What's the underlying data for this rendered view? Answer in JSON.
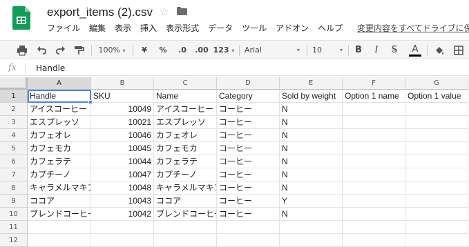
{
  "title_bar": {
    "app_icon": "sheets-icon",
    "filename": "export_items (2).csv",
    "star_icon": "star-icon",
    "folder_icon": "folder-icon",
    "last_edit": "変更内容をすべてドライブに保"
  },
  "menu": [
    "ファイル",
    "編集",
    "表示",
    "挿入",
    "表示形式",
    "データ",
    "ツール",
    "アドオン",
    "ヘルプ"
  ],
  "toolbar": {
    "print_icon": "print-icon",
    "undo_icon": "undo-icon",
    "redo_icon": "redo-icon",
    "paint_format_icon": "paint-format-icon",
    "zoom": "100%",
    "currency": "¥",
    "percent": "%",
    "dec_decrease": ".0",
    "dec_increase": ".00",
    "more_formats": "123",
    "font": "Arial",
    "font_size": "10",
    "bold": "B",
    "italic": "I",
    "strike": "S",
    "text_color": "A",
    "fill_icon": "fill-color-icon",
    "borders_icon": "borders-icon"
  },
  "formula_bar": {
    "fx": "fx",
    "value": "Handle"
  },
  "grid": {
    "columns": [
      "A",
      "B",
      "C",
      "D",
      "E",
      "F",
      "G"
    ],
    "rows": [
      "1",
      "2",
      "3",
      "4",
      "5",
      "6",
      "7",
      "8",
      "9",
      "10",
      "11",
      "12"
    ],
    "cells": [
      [
        "Handle",
        "SKU",
        "Name",
        "Category",
        "Sold by weight",
        "Option 1 name",
        "Option 1 value"
      ],
      [
        "アイスコーヒー",
        "10049",
        "アイスコーヒー",
        "コーヒー",
        "N",
        "",
        ""
      ],
      [
        "エスプレッソ",
        "10021",
        "エスプレッソ",
        "コーヒー",
        "N",
        "",
        ""
      ],
      [
        "カフェオレ",
        "10046",
        "カフェオレ",
        "コーヒー",
        "N",
        "",
        ""
      ],
      [
        "カフェモカ",
        "10045",
        "カフェモカ",
        "コーヒー",
        "N",
        "",
        ""
      ],
      [
        "カフェラテ",
        "10044",
        "カフェラテ",
        "コーヒー",
        "N",
        "",
        ""
      ],
      [
        "カプチーノ",
        "10047",
        "カプチーノ",
        "コーヒー",
        "N",
        "",
        ""
      ],
      [
        "キャラメルマキア",
        "10048",
        "キャラメルマキア",
        "コーヒー",
        "N",
        "",
        ""
      ],
      [
        "ココア",
        "10043",
        "ココア",
        "コーヒー",
        "Y",
        "",
        ""
      ],
      [
        "ブレンドコーヒー",
        "10042",
        "ブレンドコーヒー",
        "コーヒー",
        "N",
        "",
        ""
      ],
      [
        "",
        "",
        "",
        "",
        "",
        "",
        ""
      ],
      [
        "",
        "",
        "",
        "",
        "",
        "",
        ""
      ]
    ]
  },
  "colors": {
    "accent": "#4285f4",
    "sheets_green": "#0f9d58",
    "header_bg": "#f3f3f3"
  }
}
